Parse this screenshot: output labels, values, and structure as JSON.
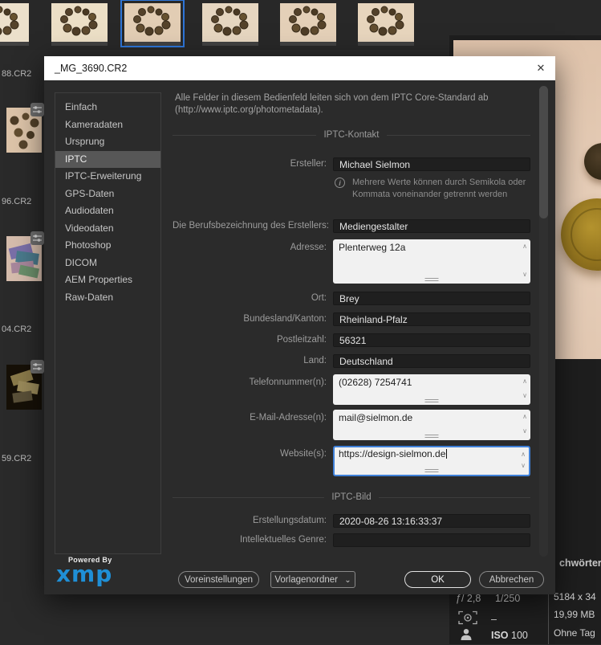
{
  "filmstrip": {
    "selected_index": 2,
    "thumb_count": 6
  },
  "left_rail": {
    "filenames": [
      "88.CR2",
      "96.CR2",
      "04.CR2",
      "59.CR2"
    ]
  },
  "preview": {
    "keywords_header_partial": "chwörter",
    "placard": {
      "aperture": "ƒ/ 2,8",
      "shutter": "1/250",
      "focus_value": "–",
      "iso_label": "ISO",
      "iso_value": "100",
      "dimensions": "5184 x 34",
      "file_size": "19,99 MB",
      "tag_status": "Ohne Tag"
    }
  },
  "icons": {
    "close": "✕",
    "dropdown_chevron": "⌄",
    "info": "i",
    "scroll_up": "∧",
    "scroll_down": "∨"
  },
  "dialog": {
    "title": "_MG_3690.CR2",
    "intro": "Alle Felder in diesem Bedienfeld leiten sich von dem IPTC Core-Standard ab (http://www.iptc.org/photometadata).",
    "nav": {
      "items": [
        "Einfach",
        "Kameradaten",
        "Ursprung",
        "IPTC",
        "IPTC-Erweiterung",
        "GPS-Daten",
        "Audiodaten",
        "Videodaten",
        "Photoshop",
        "DICOM",
        "AEM Properties",
        "Raw-Daten"
      ],
      "selected": "IPTC"
    },
    "sections": {
      "contact": "IPTC-Kontakt",
      "image": "IPTC-Bild"
    },
    "note": "Mehrere Werte können durch Semikola oder Kommata voneinander getrennt werden",
    "fields": {
      "creator": {
        "label": "Ersteller:",
        "value": "Michael Sielmon"
      },
      "job_title": {
        "label": "Die Berufsbezeichnung des Erstellers:",
        "value": "Mediengestalter"
      },
      "address": {
        "label": "Adresse:",
        "value": "Plenterweg 12a"
      },
      "city": {
        "label": "Ort:",
        "value": "Brey"
      },
      "state": {
        "label": "Bundesland/Kanton:",
        "value": "Rheinland-Pfalz"
      },
      "postal_code": {
        "label": "Postleitzahl:",
        "value": "56321"
      },
      "country": {
        "label": "Land:",
        "value": "Deutschland"
      },
      "phone": {
        "label": "Telefonnummer(n):",
        "value": "(02628) 7254741"
      },
      "email": {
        "label": "E-Mail-Adresse(n):",
        "value": "mail@sielmon.de"
      },
      "website": {
        "label": "Website(s):",
        "value": "https://design-sielmon.de"
      },
      "creation_date": {
        "label": "Erstellungsdatum:",
        "value": "2020-08-26 13:16:33:37"
      },
      "genre": {
        "label": "Intellektuelles Genre:",
        "value": ""
      }
    },
    "footer": {
      "powered_by": "Powered By",
      "logo": "xmp",
      "presets_button": "Voreinstellungen",
      "templates_dropdown": "Vorlagenordner",
      "ok_button": "OK",
      "cancel_button": "Abbrechen"
    },
    "accent_colors": {
      "focus_border": "#3f80d8",
      "selection_blue": "#2e75d8",
      "xmp_blue": "#1f8fd6"
    }
  }
}
